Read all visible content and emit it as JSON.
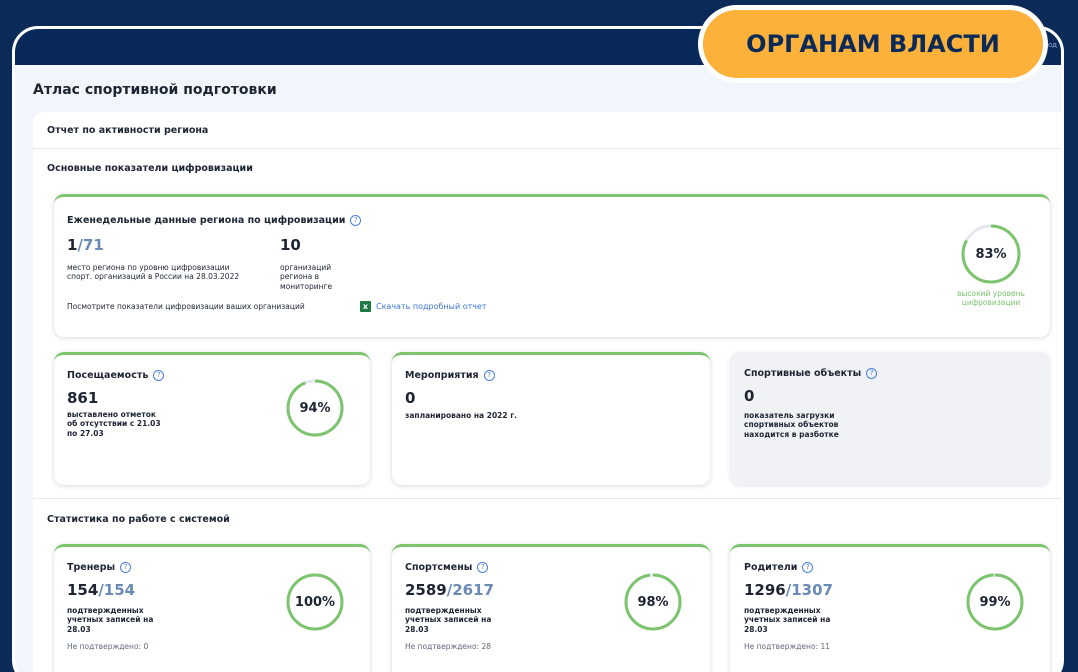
{
  "header": {
    "exit_label": "Выход",
    "banner": "ОРГАНАМ ВЛАСТИ"
  },
  "page_title": "Атлас спортивной подготовки",
  "report": {
    "title": "Отчет по активности региона"
  },
  "digitization": {
    "section_title": "Основные показатели цифровизации",
    "weekly": {
      "title": "Еженедельные данные региона по цифровизации",
      "rank_value": "1",
      "rank_total": "/71",
      "rank_desc": "место региона по уровню цифровизации спорт. организаций в России на 28.03.2022",
      "orgs_value": "10",
      "orgs_desc": "организаций региона в мониторинге",
      "view_text": "Посмотрите показатели цифровизации ваших организаций",
      "download_link": "Скачать подробный отчет",
      "gauge_label": "83%",
      "gauge_percent": 83,
      "level_text": "высокий уровень цифровизации"
    },
    "attendance": {
      "title": "Посещаемость",
      "value": "861",
      "desc": "выставлено отметок об отсутствии с 21.03 по 27.03",
      "gauge_label": "94%",
      "gauge_percent": 94
    },
    "events": {
      "title": "Мероприятия",
      "value": "0",
      "desc": "запланировано на 2022 г."
    },
    "facilities": {
      "title": "Спортивные объекты",
      "value": "0",
      "desc": "показатель загрузки спортивных объектов находится в разботке"
    }
  },
  "system": {
    "section_title": "Статистика по работе с системой",
    "coaches": {
      "title": "Тренеры",
      "value": "154",
      "total": "/154",
      "desc": "подтвержденных учетных записей на 28.03",
      "unconfirmed": "Не подтверждено: 0",
      "gauge_label": "100%",
      "gauge_percent": 100
    },
    "athletes": {
      "title": "Спортсмены",
      "value": "2589",
      "total": "/2617",
      "desc": "подтвержденных учетных записей на 28.03",
      "unconfirmed": "Не подтверждено: 28",
      "gauge_label": "98%",
      "gauge_percent": 98
    },
    "parents": {
      "title": "Родители",
      "value": "1296",
      "total": "/1307",
      "desc": "подтвержденных учетных записей на 28.03",
      "unconfirmed": "Не подтверждено: 11",
      "gauge_label": "99%",
      "gauge_percent": 99
    }
  },
  "colors": {
    "accent_green": "#7cc46d",
    "navy": "#0b2a57",
    "banner": "#fbb13a"
  }
}
